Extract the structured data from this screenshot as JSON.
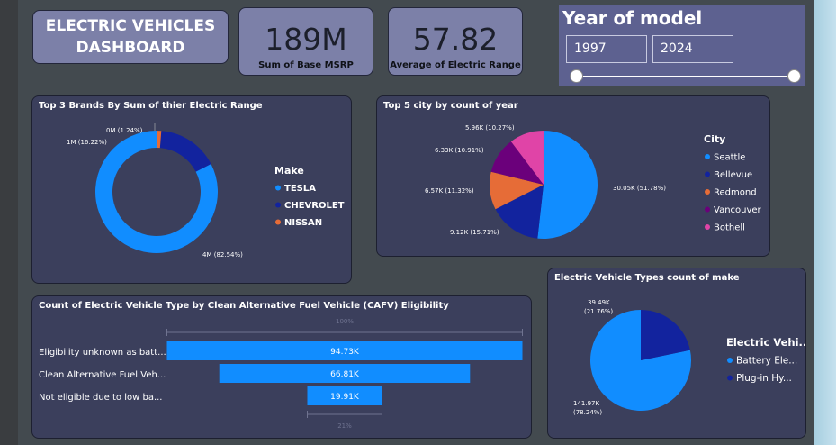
{
  "header": {
    "title_line1": "ELECTRIC VEHICLES",
    "title_line2": "DASHBOARD"
  },
  "kpis": [
    {
      "value": "189M",
      "label": "Sum of Base MSRP"
    },
    {
      "value": "57.82",
      "label": "Average of Electric Range"
    }
  ],
  "slicer": {
    "title": "Year of model",
    "start": "1997",
    "end": "2024",
    "range": [
      1997,
      2024
    ]
  },
  "colors": {
    "blue": "#118dff",
    "navy": "#12239e",
    "orange": "#e66c37",
    "purple": "#6b007b",
    "pink": "#e044a7"
  },
  "chart_data": [
    {
      "type": "pie",
      "subtype": "donut",
      "title": "Top 3 Brands By Sum of thier Electric Range",
      "legend_title": "Make",
      "legend_position": "right",
      "slices": [
        {
          "name": "TESLA",
          "value": 4,
          "label": "4M (82.54%)",
          "color": "#118dff",
          "share": 82.54
        },
        {
          "name": "CHEVROLET",
          "value": 1,
          "label": "1M (16.22%)",
          "color": "#12239e",
          "share": 16.22
        },
        {
          "name": "NISSAN",
          "value": 0,
          "label": "0M (1.24%)",
          "color": "#e66c37",
          "share": 1.24
        }
      ]
    },
    {
      "type": "pie",
      "title": "Top 5 city by count of year",
      "legend_title": "City",
      "legend_position": "right",
      "slices": [
        {
          "name": "Seattle",
          "value": 30.05,
          "label": "30.05K (51.78%)",
          "color": "#118dff",
          "share": 51.78
        },
        {
          "name": "Bellevue",
          "value": 9.12,
          "label": "9.12K (15.71%)",
          "color": "#12239e",
          "share": 15.71
        },
        {
          "name": "Redmond",
          "value": 6.57,
          "label": "6.57K (11.32%)",
          "color": "#e66c37",
          "share": 11.32
        },
        {
          "name": "Vancouver",
          "value": 6.33,
          "label": "6.33K (10.91%)",
          "color": "#6b007b",
          "share": 10.91
        },
        {
          "name": "Bothell",
          "value": 5.96,
          "label": "5.96K (10.27%)",
          "color": "#e044a7",
          "share": 10.27
        }
      ]
    },
    {
      "type": "bar",
      "subtype": "funnel",
      "title": "Count of Electric Vehicle Type by Clean Alternative Fuel Vehicle (CAFV) Eligibility",
      "categories": [
        "Eligibility unknown as batt...",
        "Clean Alternative Fuel Veh...",
        "Not eligible due to low ba..."
      ],
      "values": [
        94.73,
        66.81,
        19.91
      ],
      "value_labels": [
        "94.73K",
        "66.81K",
        "19.91K"
      ],
      "top_label": "100%",
      "bottom_label": "21%"
    },
    {
      "type": "pie",
      "title": "Electric Vehicle Types  count of make",
      "legend_title": "Electric Vehi...",
      "legend_position": "right",
      "slices": [
        {
          "name": "Battery Ele...",
          "value": 141.97,
          "label": "141.97K",
          "pct": "(78.24%)",
          "color": "#118dff",
          "share": 78.24
        },
        {
          "name": "Plug-in Hy...",
          "value": 39.49,
          "label": "39.49K",
          "pct": "(21.76%)",
          "color": "#12239e",
          "share": 21.76
        }
      ]
    }
  ]
}
